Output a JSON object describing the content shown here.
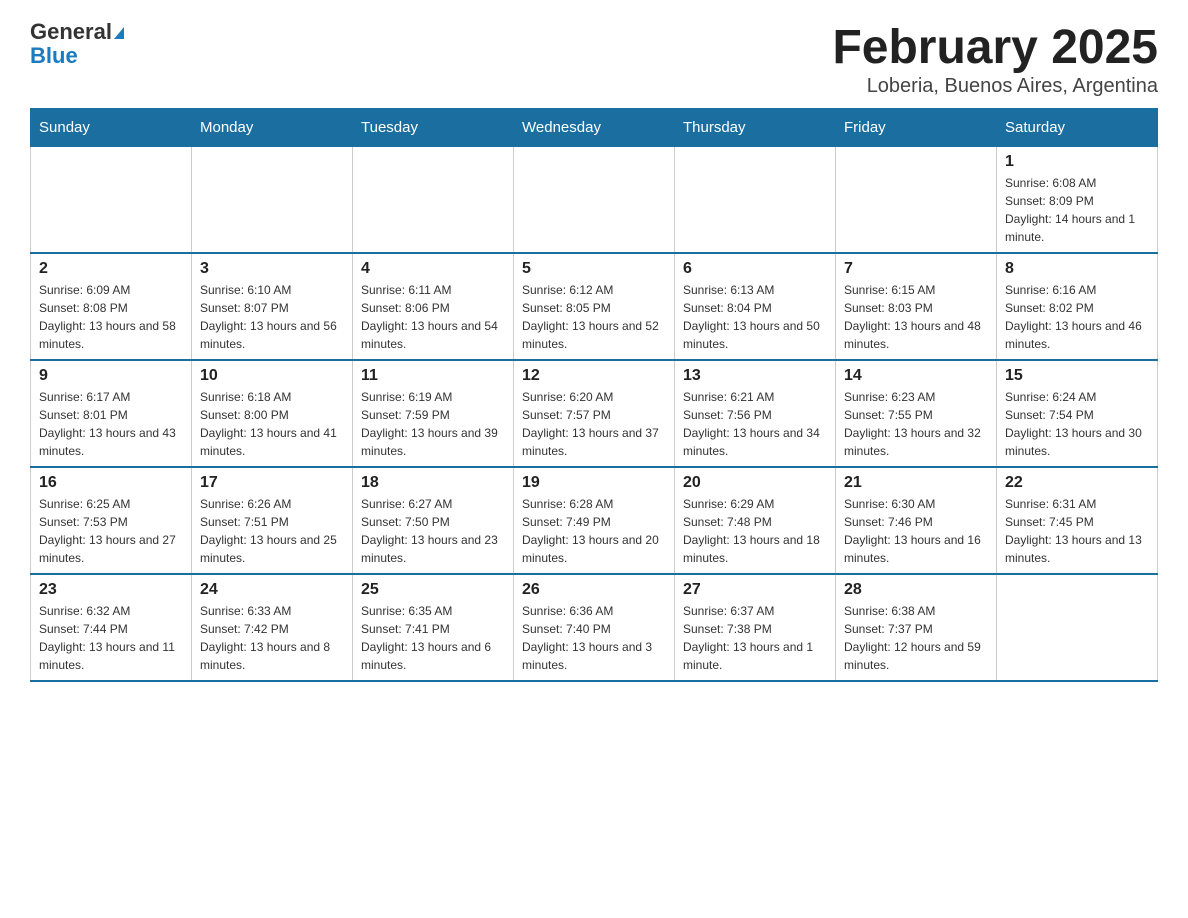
{
  "header": {
    "logo_general": "General",
    "logo_blue": "Blue",
    "title": "February 2025",
    "subtitle": "Loberia, Buenos Aires, Argentina"
  },
  "days_of_week": [
    "Sunday",
    "Monday",
    "Tuesday",
    "Wednesday",
    "Thursday",
    "Friday",
    "Saturday"
  ],
  "weeks": [
    [
      {
        "day": "",
        "info": ""
      },
      {
        "day": "",
        "info": ""
      },
      {
        "day": "",
        "info": ""
      },
      {
        "day": "",
        "info": ""
      },
      {
        "day": "",
        "info": ""
      },
      {
        "day": "",
        "info": ""
      },
      {
        "day": "1",
        "info": "Sunrise: 6:08 AM\nSunset: 8:09 PM\nDaylight: 14 hours and 1 minute."
      }
    ],
    [
      {
        "day": "2",
        "info": "Sunrise: 6:09 AM\nSunset: 8:08 PM\nDaylight: 13 hours and 58 minutes."
      },
      {
        "day": "3",
        "info": "Sunrise: 6:10 AM\nSunset: 8:07 PM\nDaylight: 13 hours and 56 minutes."
      },
      {
        "day": "4",
        "info": "Sunrise: 6:11 AM\nSunset: 8:06 PM\nDaylight: 13 hours and 54 minutes."
      },
      {
        "day": "5",
        "info": "Sunrise: 6:12 AM\nSunset: 8:05 PM\nDaylight: 13 hours and 52 minutes."
      },
      {
        "day": "6",
        "info": "Sunrise: 6:13 AM\nSunset: 8:04 PM\nDaylight: 13 hours and 50 minutes."
      },
      {
        "day": "7",
        "info": "Sunrise: 6:15 AM\nSunset: 8:03 PM\nDaylight: 13 hours and 48 minutes."
      },
      {
        "day": "8",
        "info": "Sunrise: 6:16 AM\nSunset: 8:02 PM\nDaylight: 13 hours and 46 minutes."
      }
    ],
    [
      {
        "day": "9",
        "info": "Sunrise: 6:17 AM\nSunset: 8:01 PM\nDaylight: 13 hours and 43 minutes."
      },
      {
        "day": "10",
        "info": "Sunrise: 6:18 AM\nSunset: 8:00 PM\nDaylight: 13 hours and 41 minutes."
      },
      {
        "day": "11",
        "info": "Sunrise: 6:19 AM\nSunset: 7:59 PM\nDaylight: 13 hours and 39 minutes."
      },
      {
        "day": "12",
        "info": "Sunrise: 6:20 AM\nSunset: 7:57 PM\nDaylight: 13 hours and 37 minutes."
      },
      {
        "day": "13",
        "info": "Sunrise: 6:21 AM\nSunset: 7:56 PM\nDaylight: 13 hours and 34 minutes."
      },
      {
        "day": "14",
        "info": "Sunrise: 6:23 AM\nSunset: 7:55 PM\nDaylight: 13 hours and 32 minutes."
      },
      {
        "day": "15",
        "info": "Sunrise: 6:24 AM\nSunset: 7:54 PM\nDaylight: 13 hours and 30 minutes."
      }
    ],
    [
      {
        "day": "16",
        "info": "Sunrise: 6:25 AM\nSunset: 7:53 PM\nDaylight: 13 hours and 27 minutes."
      },
      {
        "day": "17",
        "info": "Sunrise: 6:26 AM\nSunset: 7:51 PM\nDaylight: 13 hours and 25 minutes."
      },
      {
        "day": "18",
        "info": "Sunrise: 6:27 AM\nSunset: 7:50 PM\nDaylight: 13 hours and 23 minutes."
      },
      {
        "day": "19",
        "info": "Sunrise: 6:28 AM\nSunset: 7:49 PM\nDaylight: 13 hours and 20 minutes."
      },
      {
        "day": "20",
        "info": "Sunrise: 6:29 AM\nSunset: 7:48 PM\nDaylight: 13 hours and 18 minutes."
      },
      {
        "day": "21",
        "info": "Sunrise: 6:30 AM\nSunset: 7:46 PM\nDaylight: 13 hours and 16 minutes."
      },
      {
        "day": "22",
        "info": "Sunrise: 6:31 AM\nSunset: 7:45 PM\nDaylight: 13 hours and 13 minutes."
      }
    ],
    [
      {
        "day": "23",
        "info": "Sunrise: 6:32 AM\nSunset: 7:44 PM\nDaylight: 13 hours and 11 minutes."
      },
      {
        "day": "24",
        "info": "Sunrise: 6:33 AM\nSunset: 7:42 PM\nDaylight: 13 hours and 8 minutes."
      },
      {
        "day": "25",
        "info": "Sunrise: 6:35 AM\nSunset: 7:41 PM\nDaylight: 13 hours and 6 minutes."
      },
      {
        "day": "26",
        "info": "Sunrise: 6:36 AM\nSunset: 7:40 PM\nDaylight: 13 hours and 3 minutes."
      },
      {
        "day": "27",
        "info": "Sunrise: 6:37 AM\nSunset: 7:38 PM\nDaylight: 13 hours and 1 minute."
      },
      {
        "day": "28",
        "info": "Sunrise: 6:38 AM\nSunset: 7:37 PM\nDaylight: 12 hours and 59 minutes."
      },
      {
        "day": "",
        "info": ""
      }
    ]
  ]
}
